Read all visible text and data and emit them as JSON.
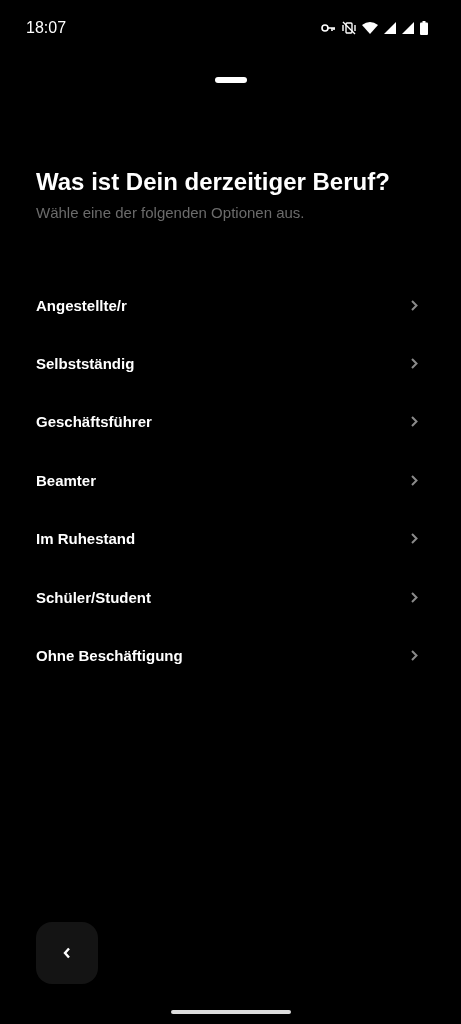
{
  "status_bar": {
    "time": "18:07"
  },
  "title": "Was ist Dein derzeitiger Beruf?",
  "subtitle": "Wähle eine der folgenden Optionen aus.",
  "options": [
    {
      "label": "Angestellte/r"
    },
    {
      "label": "Selbstständig"
    },
    {
      "label": "Geschäftsführer"
    },
    {
      "label": "Beamter"
    },
    {
      "label": "Im Ruhestand"
    },
    {
      "label": "Schüler/Student"
    },
    {
      "label": "Ohne Beschäftigung"
    }
  ]
}
